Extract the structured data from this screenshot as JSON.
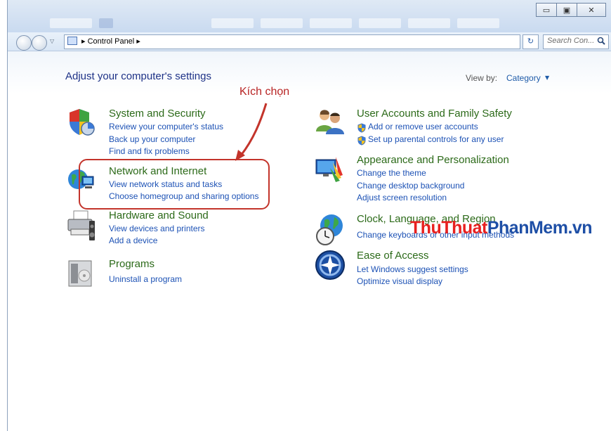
{
  "window": {
    "minimize_glyph": "▭",
    "maximize_glyph": "▣",
    "close_glyph": "✕"
  },
  "address_bar": {
    "path_separator": "▸",
    "path": "Control Panel",
    "path_trailing": "▸",
    "search_placeholder": "Search Con...",
    "search_icon": "search-icon",
    "refresh_glyph": "↻"
  },
  "page": {
    "heading": "Adjust your computer's settings",
    "view_by_label": "View by:",
    "view_by_value": "Category"
  },
  "categories": {
    "system_security": {
      "title": "System and Security",
      "icon": "shield-icon",
      "links": [
        "Review your computer's status",
        "Back up your computer",
        "Find and fix problems"
      ]
    },
    "network_internet": {
      "title": "Network and Internet",
      "icon": "globe-network-icon",
      "links": [
        "View network status and tasks",
        "Choose homegroup and sharing options"
      ]
    },
    "hardware_sound": {
      "title": "Hardware and Sound",
      "icon": "printer-icon",
      "links": [
        "View devices and printers",
        "Add a device"
      ]
    },
    "programs": {
      "title": "Programs",
      "icon": "programs-icon",
      "links": [
        "Uninstall a program"
      ]
    },
    "user_accounts": {
      "title": "User Accounts and Family Safety",
      "icon": "users-icon",
      "links": [
        "Add or remove user accounts",
        "Set up parental controls for any user"
      ]
    },
    "appearance": {
      "title": "Appearance and Personalization",
      "icon": "appearance-icon",
      "links": [
        "Change the theme",
        "Change desktop background",
        "Adjust screen resolution"
      ]
    },
    "clock_region": {
      "title": "Clock, Language, and Region",
      "icon": "clock-globe-icon",
      "links": [
        "Change keyboards or other input methods"
      ]
    },
    "ease_access": {
      "title": "Ease of Access",
      "icon": "ease-of-access-icon",
      "links": [
        "Let Windows suggest settings",
        "Optimize visual display"
      ]
    }
  },
  "annotation": {
    "label": "Kích chọn",
    "color": "#b82424"
  },
  "watermark": {
    "part1": "ThuThuat",
    "part2": "PhanMem.vn"
  },
  "colors": {
    "title_green": "#2c6a19",
    "link_blue": "#1d52b5",
    "heading_blue": "#1e3287"
  }
}
